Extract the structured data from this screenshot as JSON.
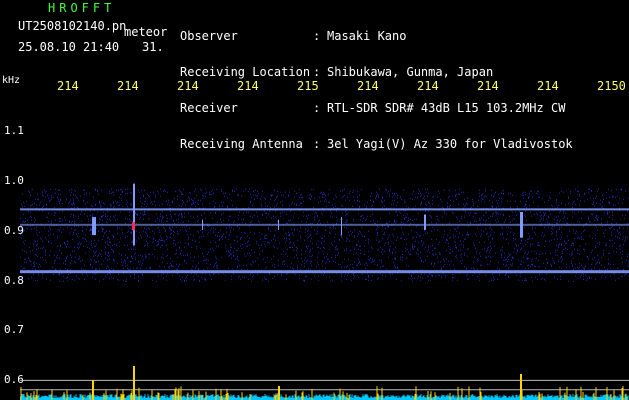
{
  "header": {
    "app_title": "HROFFT",
    "file_name": "UT2508102140.pn",
    "meteor_label": "meteor",
    "date_time": "25.08.10 21:40",
    "meteor_count": "31."
  },
  "info": {
    "rows": [
      {
        "label": "Observer",
        "value": "Masaki Kano"
      },
      {
        "label": "Receiving Location",
        "value": "Shibukawa, Gunma, Japan"
      },
      {
        "label": "Receiver",
        "value": "RTL-SDR SDR# 43dB L15 103.2MHz CW"
      },
      {
        "label": "Receiving Antenna",
        "value": "3el Yagi(V) Az 330 for Vladivostok"
      }
    ],
    "separator": ":"
  },
  "axes": {
    "y_unit": "kHz",
    "y_ticks": [
      "1.1",
      "1.0",
      "0.9",
      "0.8",
      "0.7",
      "0.6"
    ],
    "x_ticks": [
      "214",
      "214",
      "214",
      "214",
      "215",
      "214",
      "214",
      "214",
      "214",
      "2150"
    ]
  },
  "chart_data": {
    "type": "heatmap",
    "x_tick_labels": [
      "214",
      "214",
      "214",
      "214",
      "215",
      "214",
      "214",
      "214",
      "214",
      "2150"
    ],
    "y_tick_labels": [
      "1.1",
      "1.0",
      "0.9",
      "0.8",
      "0.7",
      "0.6"
    ],
    "ylabel": "kHz",
    "ylim": [
      0.58,
      1.17
    ],
    "bands_khz": [
      0.95,
      0.92,
      0.83
    ],
    "colors": {
      "background": "#000000",
      "noise": "#2a3cff",
      "signal": "#7f9cff",
      "strong": "#ff2a5a",
      "waterfall_bar": "#ffd400",
      "baseline": "#00c8ff"
    }
  }
}
